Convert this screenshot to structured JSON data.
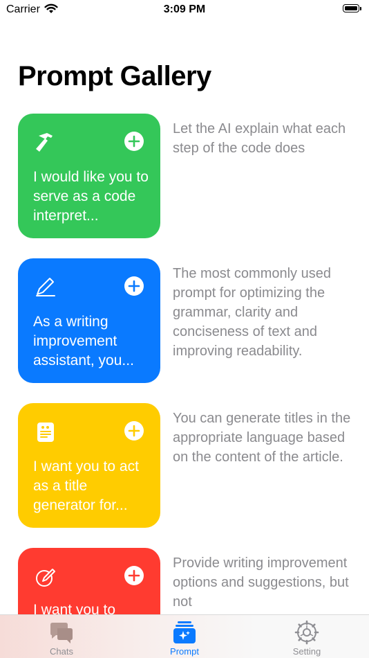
{
  "status_bar": {
    "carrier": "Carrier",
    "time": "3:09 PM"
  },
  "page": {
    "title": "Prompt Gallery"
  },
  "prompts": [
    {
      "color": "#34c759",
      "icon": "hammer-icon",
      "preview": "I would like you to serve as a code interpret...",
      "description": "Let the AI explain what each step of the code does"
    },
    {
      "color": "#0a7aff",
      "icon": "pencil-icon",
      "preview": "As a writing improvement assistant, you...",
      "description": "The most commonly used prompt for optimizing the grammar, clarity and conciseness of text and improving readability."
    },
    {
      "color": "#ffcc00",
      "icon": "title-card-icon",
      "preview": "I want you to act as a title generator for...",
      "description": "You can generate titles in the appropriate language based on the content of the article."
    },
    {
      "color": "#ff3b30",
      "icon": "edit-circle-icon",
      "preview": "I want you to",
      "description": "Provide writing improvement options and suggestions, but not"
    }
  ],
  "tab_bar": {
    "active_color": "#0a7aff",
    "tabs": [
      {
        "label": "Chats",
        "icon": "chat-bubbles-icon",
        "active": false
      },
      {
        "label": "Prompt",
        "icon": "sparkles-card-icon",
        "active": true
      },
      {
        "label": "Setting",
        "icon": "gear-icon",
        "active": false
      }
    ]
  }
}
